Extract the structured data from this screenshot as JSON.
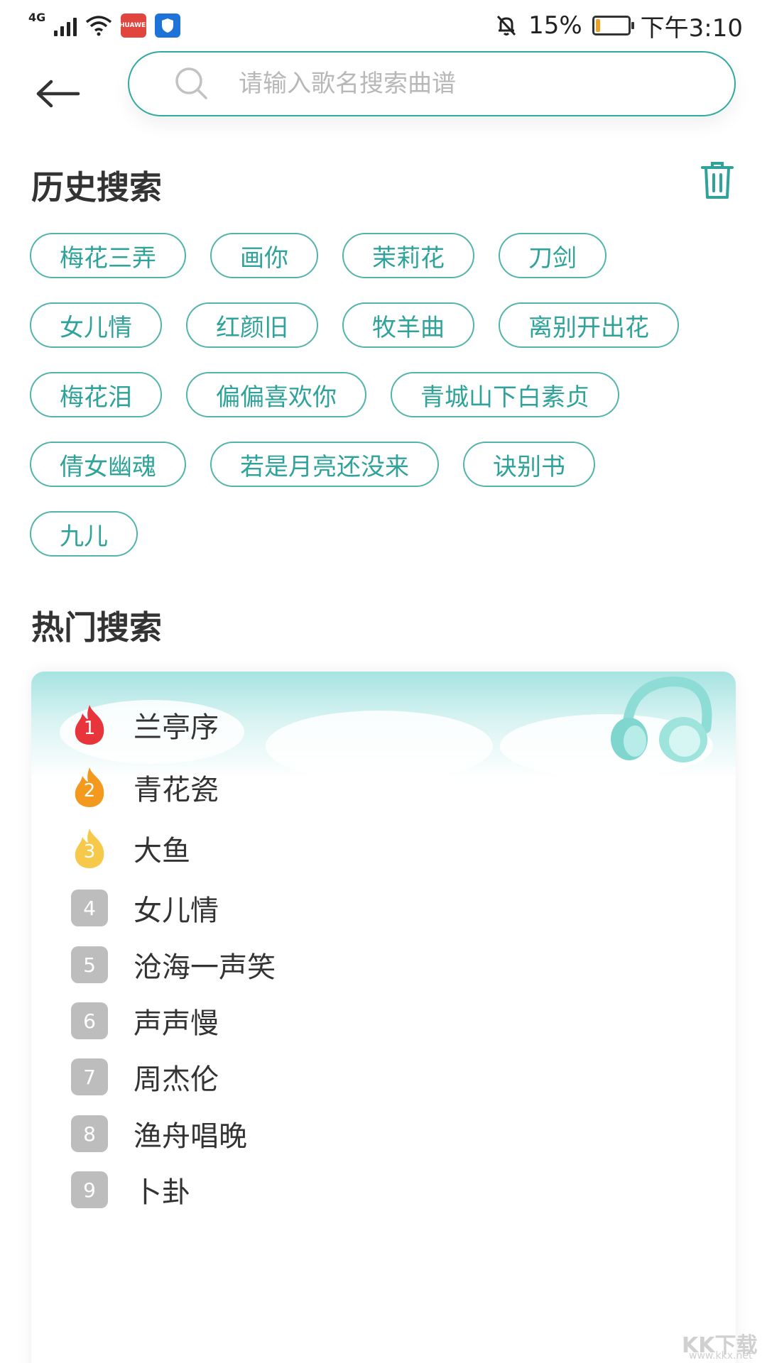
{
  "status_bar": {
    "network": "4G",
    "battery_percent": "15%",
    "battery_level": 0.15,
    "time": "下午3:10",
    "app_badge_label": "HUAWEI"
  },
  "search": {
    "placeholder": "请输入歌名搜索曲谱"
  },
  "history": {
    "title": "历史搜索",
    "rows": [
      [
        "梅花三弄",
        "画你",
        "茉莉花",
        "刀剑"
      ],
      [
        "女儿情",
        "红颜旧",
        "牧羊曲",
        "离别开出花"
      ],
      [
        "梅花泪",
        "偏偏喜欢你",
        "青城山下白素贞"
      ],
      [
        "倩女幽魂",
        "若是月亮还没来",
        "诀别书"
      ],
      [
        "九儿"
      ]
    ]
  },
  "hot": {
    "title": "热门搜索",
    "items": [
      {
        "rank": "1",
        "label": "兰亭序",
        "style": "flame",
        "color": "#e8343b"
      },
      {
        "rank": "2",
        "label": "青花瓷",
        "style": "flame",
        "color": "#f39a1e"
      },
      {
        "rank": "3",
        "label": "大鱼",
        "style": "flame",
        "color": "#f7c94a"
      },
      {
        "rank": "4",
        "label": "女儿情",
        "style": "box"
      },
      {
        "rank": "5",
        "label": "沧海一声笑",
        "style": "box"
      },
      {
        "rank": "6",
        "label": "声声慢",
        "style": "box"
      },
      {
        "rank": "7",
        "label": "周杰伦",
        "style": "box"
      },
      {
        "rank": "8",
        "label": "渔舟唱晚",
        "style": "box"
      },
      {
        "rank": "9",
        "label": "卜卦",
        "style": "box"
      }
    ]
  },
  "watermark": {
    "text": "KK下载",
    "url": "www.kkx.net"
  },
  "colors": {
    "accent": "#2fa39a",
    "tag_border": "#52b4aa",
    "rank_box": "#bdbdbd"
  }
}
